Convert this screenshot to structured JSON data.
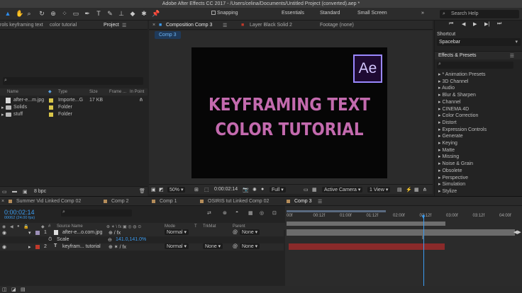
{
  "titlebar": "Adobe After Effects CC 2017 - /Users/celina/Documents/Untitled Project (converted).aep *",
  "toolbar": {
    "snapping": "Snapping",
    "workspaces": [
      "Essentials",
      "Standard",
      "Small Screen"
    ],
    "search_placeholder": "Search Help"
  },
  "project_panel": {
    "tabs": [
      "rols keyframing text",
      "color tutorial",
      "Project"
    ],
    "columns": [
      "Name",
      "Type",
      "Size",
      "Frame ...",
      "In Point"
    ],
    "items": [
      {
        "name": "after-e...m.jpg",
        "type": "Importe...G",
        "size": "17 KB",
        "color": "#d9c64a"
      },
      {
        "name": "Solids",
        "type": "Folder",
        "size": "",
        "color": "#d9c64a"
      },
      {
        "name": "stuff",
        "type": "Folder",
        "size": "",
        "color": "#d9c64a"
      }
    ],
    "bpc": "8 bpc"
  },
  "viewer": {
    "tabs": [
      "Composition Comp 3",
      "Layer Black Solid 2",
      "Footage (none)"
    ],
    "comp_tab": "Comp 3",
    "logo": "Ae",
    "line1": "KEYFRAMING TEXT",
    "line2": "COLOR TUTORIAL",
    "text_color": "#c36aae",
    "zoom": "50%",
    "timecode": "0:00:02:14",
    "resolution": "Full",
    "camera": "Active Camera",
    "view": "1 View"
  },
  "right_panel": {
    "shortcut_label": "Shortcut",
    "shortcut_value": "Spacebar",
    "effects_title": "Effects & Presets",
    "effects": [
      "* Animation Presets",
      "3D Channel",
      "Audio",
      "Blur & Sharpen",
      "Channel",
      "CINEMA 4D",
      "Color Correction",
      "Distort",
      "Expression Controls",
      "Generate",
      "Keying",
      "Matte",
      "Missing",
      "Noise & Grain",
      "Obsolete",
      "Perspective",
      "Simulation",
      "Stylize"
    ]
  },
  "timeline": {
    "tabs": [
      "Summer Vid Linked Comp 02",
      "Comp 2",
      "Comp 1",
      "OSIRIS tut Linked Comp 02",
      "Comp 3"
    ],
    "timecode": "0:00:02:14",
    "fps": "00062 (24.00 fps)",
    "columns": [
      "Source Name",
      "Mode",
      "T",
      "TrkMat",
      "Parent"
    ],
    "ruler": [
      "00f",
      "00:12f",
      "01:00f",
      "01:12f",
      "02:00f",
      "02:12f",
      "03:00f",
      "03:12f",
      "04:00f"
    ],
    "layers": [
      {
        "num": "1",
        "name": "after-e...o.com.jpg",
        "mode": "Normal",
        "trkmat": "",
        "parent": "None"
      },
      {
        "num": "2",
        "name": "keyfram... tutorial",
        "mode": "Normal",
        "trkmat": "None",
        "parent": "None"
      }
    ],
    "scale_label": "Scale",
    "scale_value": "141.0,141.0%"
  }
}
